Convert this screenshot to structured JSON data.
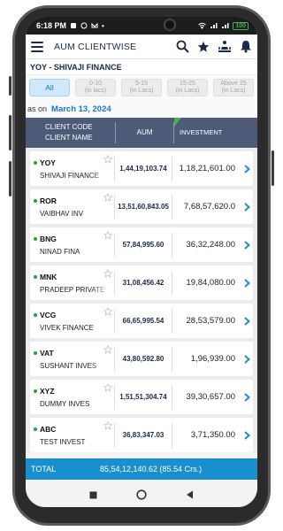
{
  "status": {
    "time": "6:18 PM",
    "battery": "100"
  },
  "app": {
    "title": "AUM CLIENTWISE"
  },
  "client_header": "YOY - SHIVAJI FINANCE",
  "filters": [
    {
      "label": "All",
      "sub": ""
    },
    {
      "label": "0-10",
      "sub": "(in lacs)"
    },
    {
      "label": "5-15",
      "sub": "(in Lacs)"
    },
    {
      "label": "15-25",
      "sub": "(in Lacs)"
    },
    {
      "label": "Above 25",
      "sub": "(in Lacs)"
    }
  ],
  "asof": {
    "label": "as on",
    "date": "March 13, 2024"
  },
  "table": {
    "headers": {
      "client_code": "CLIENT CODE",
      "client_name": "CLIENT NAME",
      "aum": "AUM",
      "investment": "INVESTMENT"
    },
    "rows": [
      {
        "code": "YOY",
        "name": "SHIVAJI FINANCE",
        "aum": "1,44,19,103.74",
        "investment": "1,18,21,601.00"
      },
      {
        "code": "ROR",
        "name": "VAIBHAV INV",
        "aum": "13,51,60,843.05",
        "investment": "7,68,57,620.0"
      },
      {
        "code": "BNG",
        "name": "NINAD FINA",
        "aum": "57,84,995.60",
        "investment": "36,32,248.00"
      },
      {
        "code": "MNK",
        "name": "PRADEEP PRIVATE",
        "aum": "31,08,456.42",
        "investment": "19,84,080.00"
      },
      {
        "code": "VCG",
        "name": "VIVEK FINANCE",
        "aum": "66,65,995.54",
        "investment": "28,53,579.00"
      },
      {
        "code": "VAT",
        "name": "SUSHANT INVES",
        "aum": "43,80,592.80",
        "investment": "1,96,939.00"
      },
      {
        "code": "XYZ",
        "name": "DUMMY INVES",
        "aum": "1,51,51,304.74",
        "investment": "39,30,657.00"
      },
      {
        "code": "ABC",
        "name": "TEST INVEST",
        "aum": "36,83,347.03",
        "investment": "3,71,350.00"
      }
    ]
  },
  "total": {
    "label": "TOTAL",
    "value": "85,54,12,140.62  (85.54 Crs.)"
  },
  "colors": {
    "accent": "#1a8fd0",
    "header": "#4d5b78",
    "date": "#1976d2",
    "chevron": "#1a8fd0",
    "active_dot": "#2e9e3e"
  }
}
